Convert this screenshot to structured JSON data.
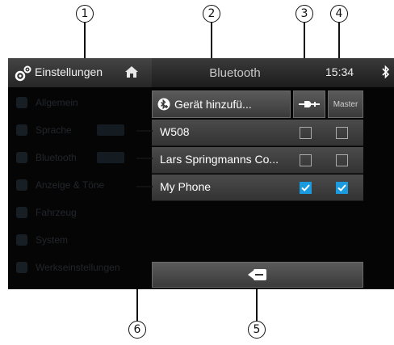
{
  "callouts": [
    "1",
    "2",
    "3",
    "4",
    "5",
    "6"
  ],
  "topbar": {
    "settings_label": "Einstellungen",
    "title": "Bluetooth",
    "time": "15:34",
    "icons": [
      "gear-icon",
      "home-icon",
      "bluetooth-icon"
    ]
  },
  "toolbar": {
    "add_device_label": "Gerät hinzufü...",
    "audio_column_icon": "audio-connector-icon",
    "master_label": "Master"
  },
  "devices": [
    {
      "name": "W508",
      "audio": false,
      "master": false
    },
    {
      "name": "Lars Springmanns Co...",
      "audio": false,
      "master": false
    },
    {
      "name": "My Phone",
      "audio": true,
      "master": true
    }
  ],
  "footer": {
    "back_icon": "back-icon"
  },
  "colors": {
    "accent": "#1a9be0",
    "background": "#050505"
  }
}
